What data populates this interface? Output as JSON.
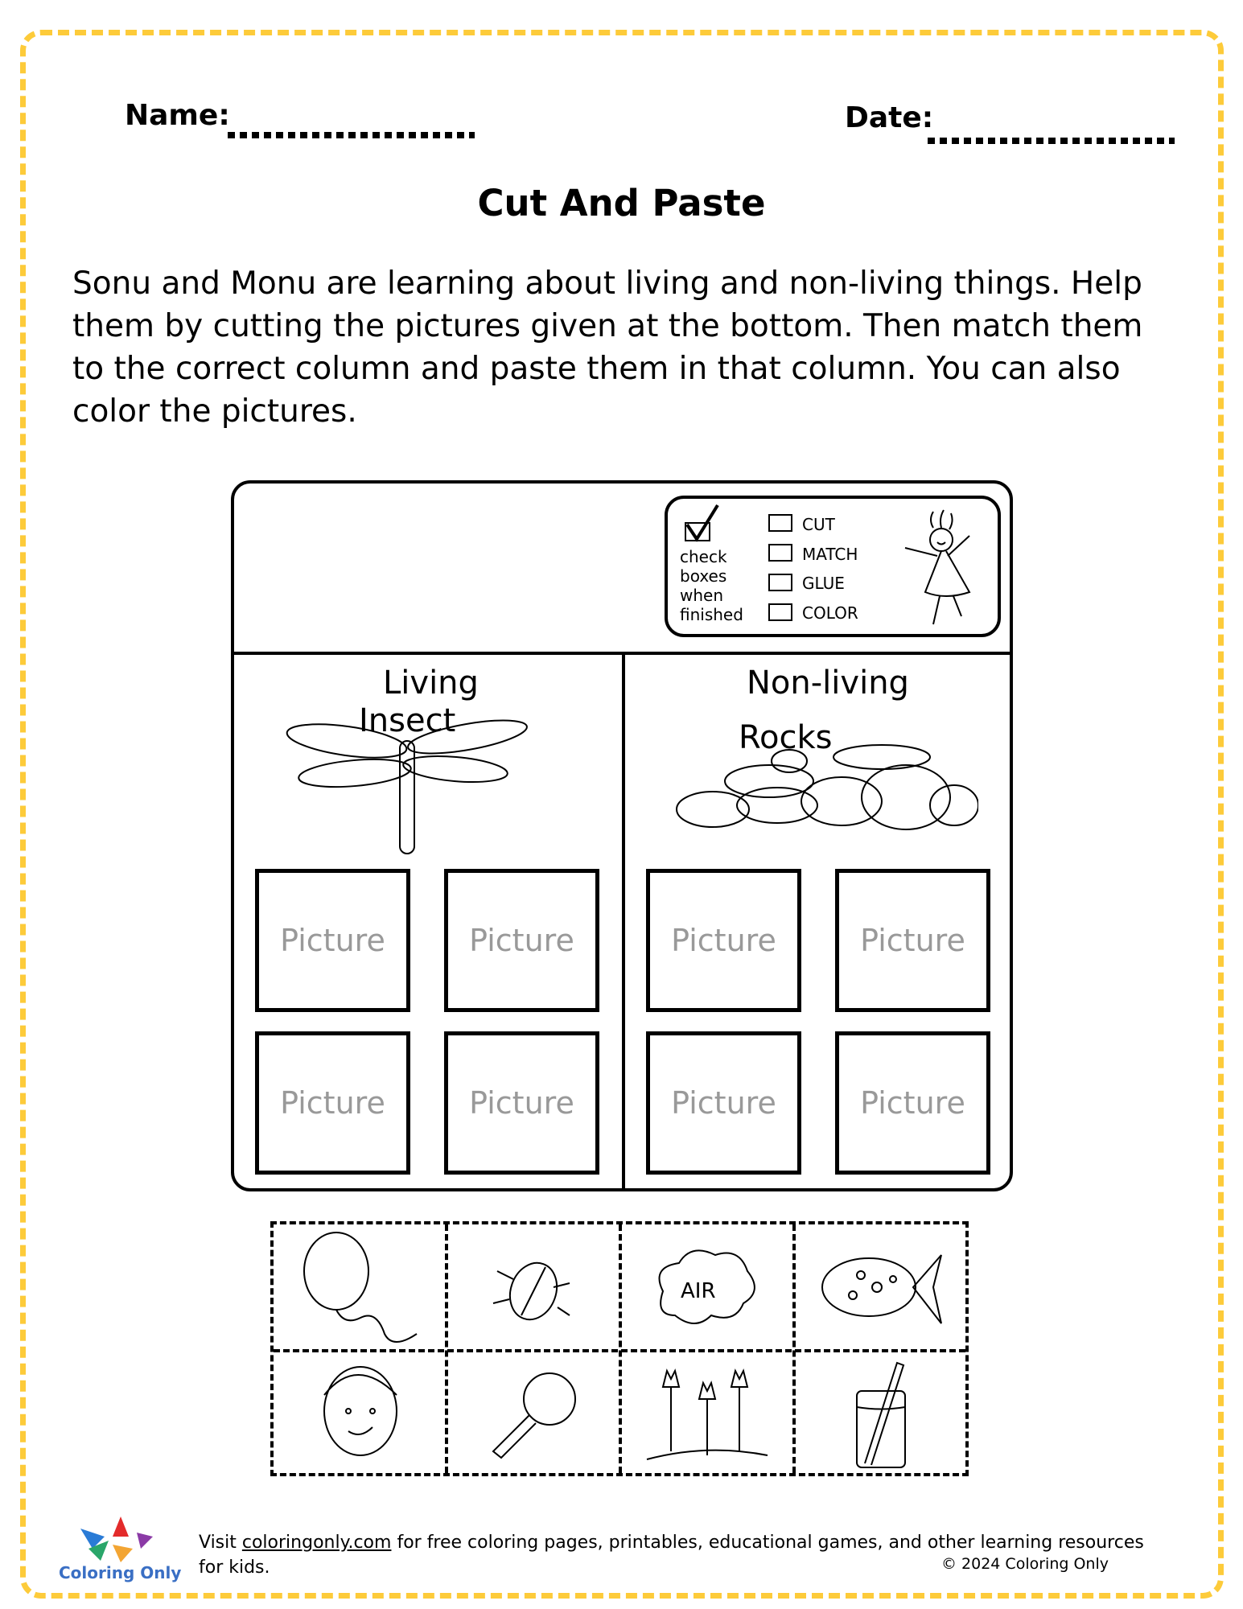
{
  "header": {
    "name_label": "Name:",
    "date_label": "Date:"
  },
  "title": "Cut And Paste",
  "instructions": "Sonu and Monu are learning about living and non-living things. Help them by cutting the pictures given at the bottom. Then match them to the correct column and paste them in that column. You can also color the pictures.",
  "checklist": {
    "note": [
      "check",
      "boxes",
      "when",
      "finished"
    ],
    "items": [
      "CUT",
      "MATCH",
      "GLUE",
      "COLOR"
    ]
  },
  "columns": [
    {
      "heading": "Living",
      "example_label": "Insect",
      "example_icon": "dragonfly-icon"
    },
    {
      "heading": "Non-living",
      "example_label": "Rocks",
      "example_icon": "rocks-icon"
    }
  ],
  "placeholder_text": "Picture",
  "cut_items": [
    "balloon",
    "beetle",
    "air-cloud",
    "fish",
    "boy",
    "magnifying-glass",
    "tulips",
    "glass-with-straw"
  ],
  "cut_air_text": "AIR",
  "footer": {
    "visit": "Visit ",
    "link": "coloringonly.com",
    "rest": " for free coloring pages, printables, educational games, and other learning resources for kids.",
    "copyright": "© 2024 Coloring Only",
    "logo_text": "Coloring Only"
  },
  "colors": {
    "border": "#fdcb3a",
    "placeholder": "#999999",
    "logo_text": "#3a6fc4"
  }
}
